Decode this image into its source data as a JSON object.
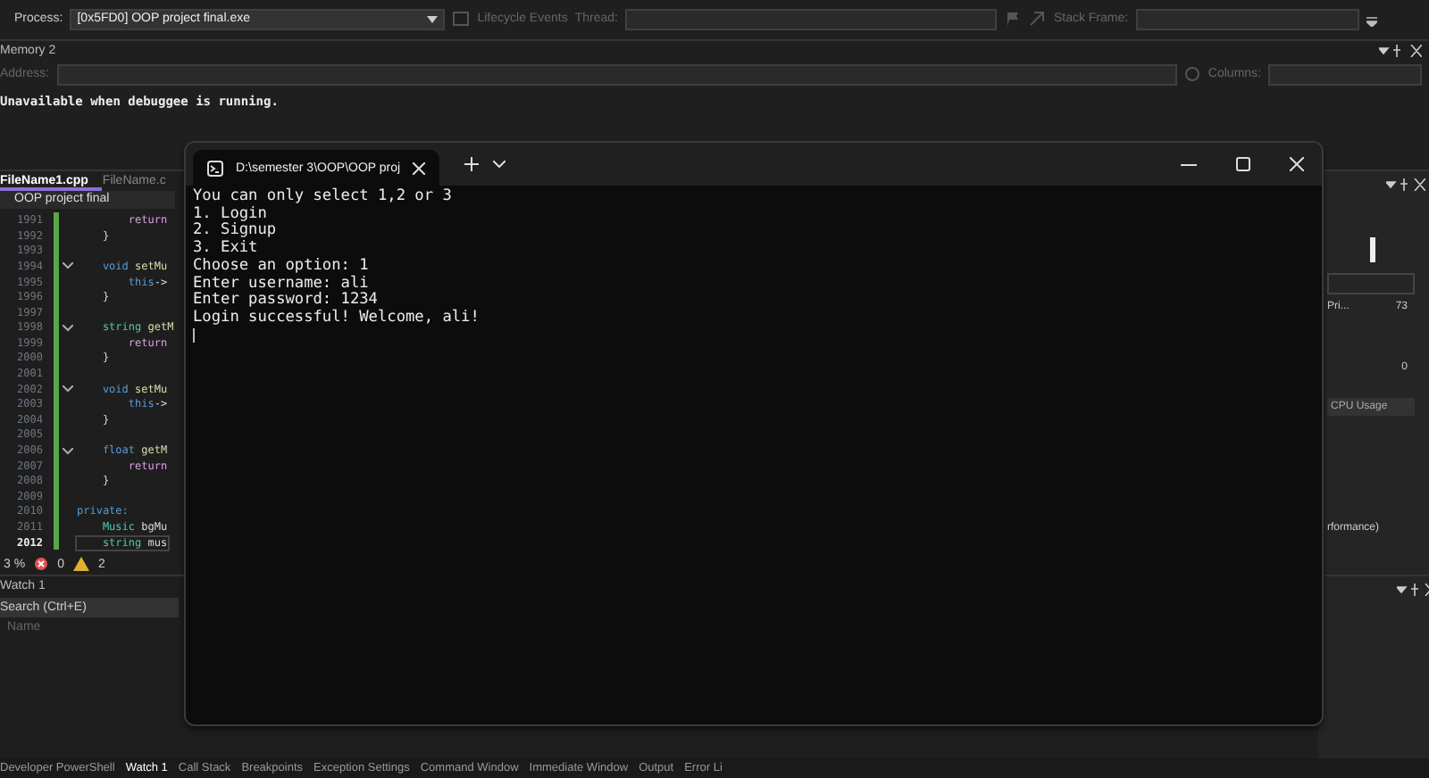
{
  "toolbar": {
    "process_label": "Process:",
    "process_value": "[0x5FD0] OOP project final.exe",
    "lifecycle": "Lifecycle Events",
    "thread_label": "Thread:",
    "stack_frame_label": "Stack Frame:"
  },
  "memory_panel": {
    "title": "Memory 2",
    "address_label": "Address:",
    "columns_label": "Columns:",
    "message": "Unavailable when debuggee is running."
  },
  "editor": {
    "tabs": [
      {
        "label": "FileName1.cpp",
        "selected": true
      },
      {
        "label": "FileName.c",
        "selected": false
      }
    ],
    "scope": "OOP project final",
    "lines": [
      {
        "number": "1991",
        "fold": false,
        "current": false,
        "tokens": [
          {
            "text": "        return",
            "kind": "control"
          }
        ]
      },
      {
        "number": "1992",
        "fold": false,
        "current": false,
        "tokens": [
          {
            "text": "    }",
            "kind": "plain"
          }
        ]
      },
      {
        "number": "1993",
        "fold": false,
        "current": false
      },
      {
        "number": "1994",
        "fold": true,
        "current": false,
        "tokens": [
          {
            "text": "    void",
            "kind": "keyword"
          },
          {
            "text": " setMu",
            "kind": "function"
          }
        ]
      },
      {
        "number": "1995",
        "fold": false,
        "current": false,
        "tokens": [
          {
            "text": "        this",
            "kind": "keyword"
          },
          {
            "text": "->",
            "kind": "plain"
          }
        ]
      },
      {
        "number": "1996",
        "fold": false,
        "current": false,
        "tokens": [
          {
            "text": "    }",
            "kind": "plain"
          }
        ]
      },
      {
        "number": "1997",
        "fold": false,
        "current": false
      },
      {
        "number": "1998",
        "fold": true,
        "current": false,
        "tokens": [
          {
            "text": "    string",
            "kind": "type"
          },
          {
            "text": " getM",
            "kind": "function"
          }
        ]
      },
      {
        "number": "1999",
        "fold": false,
        "current": false,
        "tokens": [
          {
            "text": "        return",
            "kind": "control"
          }
        ]
      },
      {
        "number": "2000",
        "fold": false,
        "current": false,
        "tokens": [
          {
            "text": "    }",
            "kind": "plain"
          }
        ]
      },
      {
        "number": "2001",
        "fold": false,
        "current": false
      },
      {
        "number": "2002",
        "fold": true,
        "current": false,
        "tokens": [
          {
            "text": "    void",
            "kind": "keyword"
          },
          {
            "text": " setMu",
            "kind": "function"
          }
        ]
      },
      {
        "number": "2003",
        "fold": false,
        "current": false,
        "tokens": [
          {
            "text": "        this",
            "kind": "keyword"
          },
          {
            "text": "->",
            "kind": "plain"
          }
        ]
      },
      {
        "number": "2004",
        "fold": false,
        "current": false,
        "tokens": [
          {
            "text": "    }",
            "kind": "plain"
          }
        ]
      },
      {
        "number": "2005",
        "fold": false,
        "current": false
      },
      {
        "number": "2006",
        "fold": true,
        "current": false,
        "tokens": [
          {
            "text": "    float",
            "kind": "keyword"
          },
          {
            "text": " getM",
            "kind": "function"
          }
        ]
      },
      {
        "number": "2007",
        "fold": false,
        "current": false,
        "tokens": [
          {
            "text": "        return",
            "kind": "control"
          }
        ]
      },
      {
        "number": "2008",
        "fold": false,
        "current": false,
        "tokens": [
          {
            "text": "    }",
            "kind": "plain"
          }
        ]
      },
      {
        "number": "2009",
        "fold": false,
        "current": false
      },
      {
        "number": "2010",
        "fold": false,
        "current": false,
        "tokens": [
          {
            "text": "private:",
            "kind": "keyword"
          }
        ]
      },
      {
        "number": "2011",
        "fold": false,
        "current": false,
        "tokens": [
          {
            "text": "    Music",
            "kind": "type"
          },
          {
            "text": " bgMu",
            "kind": "plain"
          }
        ]
      },
      {
        "number": "2012",
        "fold": false,
        "current": true,
        "tokens": [
          {
            "text": "    string",
            "kind": "type"
          },
          {
            "text": " mus",
            "kind": "plain"
          }
        ]
      }
    ],
    "zoom": "3 %",
    "errors": "0",
    "warnings": "2"
  },
  "right_panel": {
    "label": "Pri...",
    "max": "73",
    "min": "0",
    "tab": "CPU Usage",
    "row": "rformance)"
  },
  "watch_panel": {
    "title": "Watch 1",
    "search": {
      "placeholder": "Search (Ctrl+E)"
    },
    "column": "Name"
  },
  "bottom_tabs": [
    {
      "label": "Developer PowerShell",
      "selected": false
    },
    {
      "label": "Watch 1",
      "selected": true
    },
    {
      "label": "Call Stack",
      "selected": false
    },
    {
      "label": "Breakpoints",
      "selected": false
    },
    {
      "label": "Exception Settings",
      "selected": false
    },
    {
      "label": "Command Window",
      "selected": false
    },
    {
      "label": "Immediate Window",
      "selected": false
    },
    {
      "label": "Output",
      "selected": false
    },
    {
      "label": "Error Li",
      "selected": false
    }
  ],
  "terminal": {
    "tab_title": "D:\\semester 3\\OOP\\OOP proj",
    "lines": [
      "You can only select 1,2 or 3",
      "1. Login",
      "2. Signup",
      "3. Exit",
      "Choose an option: 1",
      "Enter username: ali",
      "Enter password: 1234",
      "Login successful! Welcome, ali!"
    ]
  }
}
